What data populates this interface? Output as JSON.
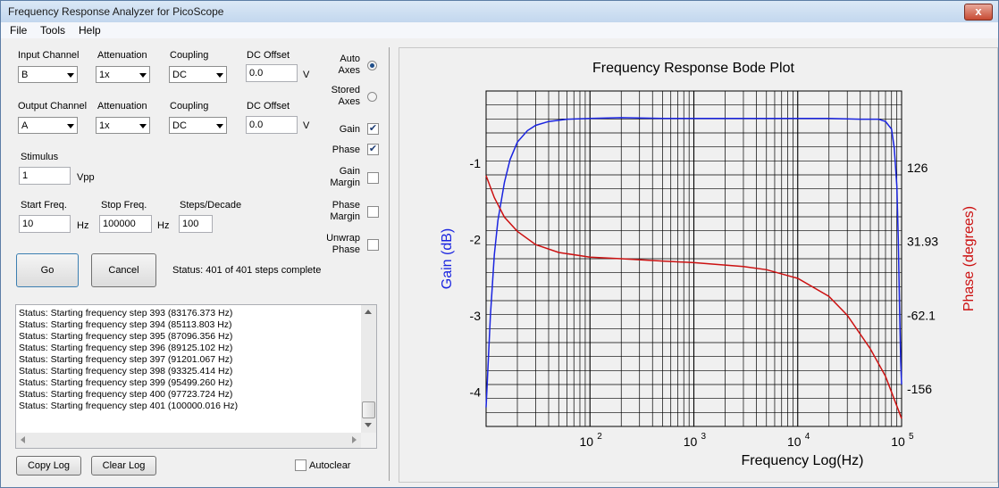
{
  "window": {
    "title": "Frequency Response Analyzer for PicoScope",
    "close": "x"
  },
  "menu": [
    "File",
    "Tools",
    "Help"
  ],
  "input": {
    "channel_label": "Input Channel",
    "channel": "B",
    "atten_label": "Attenuation",
    "atten": "1x",
    "coupling_label": "Coupling",
    "coupling": "DC",
    "offset_label": "DC Offset",
    "offset": "0.0",
    "offset_unit": "V"
  },
  "output": {
    "channel_label": "Output Channel",
    "channel": "A",
    "atten_label": "Attenuation",
    "atten": "1x",
    "coupling_label": "Coupling",
    "coupling": "DC",
    "offset_label": "DC Offset",
    "offset": "0.0",
    "offset_unit": "V"
  },
  "stimulus": {
    "label": "Stimulus",
    "value": "1",
    "unit": "Vpp"
  },
  "sweep": {
    "start_label": "Start Freq.",
    "start": "10",
    "start_unit": "Hz",
    "stop_label": "Stop Freq.",
    "stop": "100000",
    "stop_unit": "Hz",
    "steps_label": "Steps/Decade",
    "steps": "100"
  },
  "options": {
    "auto_axes": [
      "Auto",
      "Axes"
    ],
    "stored_axes": [
      "Stored",
      "Axes"
    ],
    "gain": "Gain",
    "phase": "Phase",
    "gain_margin": [
      "Gain",
      "Margin"
    ],
    "phase_margin": [
      "Phase",
      "Margin"
    ],
    "unwrap_phase": [
      "Unwrap",
      "Phase"
    ],
    "check_mark": "✔"
  },
  "buttons": {
    "go": "Go",
    "cancel": "Cancel",
    "copy_log": "Copy Log",
    "clear_log": "Clear Log",
    "autoclear": "Autoclear"
  },
  "status": "Status: 401 of 401 steps complete",
  "log": [
    "Status: Starting frequency step 393 (83176.373 Hz)",
    "Status: Starting frequency step 394 (85113.803 Hz)",
    "Status: Starting frequency step 395 (87096.356 Hz)",
    "Status: Starting frequency step 396 (89125.102 Hz)",
    "Status: Starting frequency step 397 (91201.067 Hz)",
    "Status: Starting frequency step 398 (93325.414 Hz)",
    "Status: Starting frequency step 399 (95499.260 Hz)",
    "Status: Starting frequency step 400 (97723.724 Hz)",
    "Status: Starting frequency step 401 (100000.016 Hz)"
  ],
  "chart_data": {
    "type": "line",
    "title": "Frequency Response Bode Plot",
    "xlabel": "Frequency Log(Hz)",
    "ylabel_left": "Gain (dB)",
    "ylabel_right": "Phase (degrees)",
    "x_scale": "log",
    "xlim": [
      10,
      100000
    ],
    "ylim_left": [
      -4.45,
      -0.05
    ],
    "ylim_right": [
      -204,
      224
    ],
    "x_tick_labels": [
      {
        "base": "10",
        "exp": "2"
      },
      {
        "base": "10",
        "exp": "3"
      },
      {
        "base": "10",
        "exp": "4"
      },
      {
        "base": "10",
        "exp": "5"
      }
    ],
    "y_left_ticks": [
      "-1",
      "-2",
      "-3",
      "-4"
    ],
    "y_right_ticks": [
      "126",
      "31.93",
      "-62.1",
      "-156"
    ],
    "grid": true,
    "series": [
      {
        "name": "Gain (dB)",
        "color": "#1a24e0",
        "axis": "left",
        "x": [
          10,
          11,
          12,
          13,
          15,
          17,
          20,
          25,
          30,
          40,
          60,
          100,
          200,
          500,
          1000,
          2000,
          5000,
          10000,
          20000,
          40000,
          60000,
          70000,
          80000,
          85000,
          90000,
          93000,
          96000,
          98000,
          100000
        ],
        "y": [
          -4.2,
          -3.0,
          -2.2,
          -1.75,
          -1.25,
          -0.95,
          -0.72,
          -0.57,
          -0.5,
          -0.45,
          -0.42,
          -0.41,
          -0.4,
          -0.41,
          -0.41,
          -0.41,
          -0.41,
          -0.41,
          -0.41,
          -0.42,
          -0.42,
          -0.45,
          -0.55,
          -0.8,
          -1.3,
          -2.0,
          -3.0,
          -3.6,
          -3.9
        ]
      },
      {
        "name": "Phase (degrees)",
        "color": "#cc1111",
        "axis": "right",
        "x": [
          10,
          12,
          15,
          20,
          30,
          50,
          100,
          200,
          500,
          1000,
          3000,
          5000,
          10000,
          20000,
          30000,
          50000,
          70000,
          90000,
          100000
        ],
        "y": [
          116,
          88,
          63,
          45,
          28,
          18,
          12,
          10,
          7,
          5,
          0,
          -4,
          -15,
          -38,
          -62,
          -105,
          -140,
          -178,
          -194
        ]
      }
    ],
    "colors": {
      "title": "#000000",
      "gain_axis": "#1a24e0",
      "phase_axis": "#cc1111",
      "grid": "#000000"
    }
  }
}
